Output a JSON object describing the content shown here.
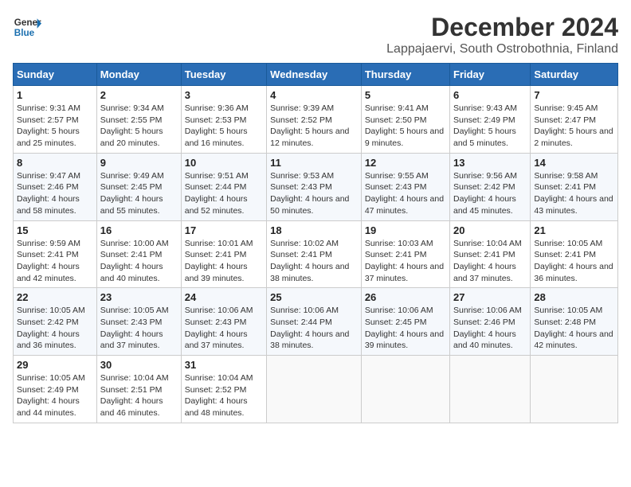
{
  "logo": {
    "general": "General",
    "blue": "Blue"
  },
  "title": "December 2024",
  "subtitle": "Lappajaervi, South Ostrobothnia, Finland",
  "weekdays": [
    "Sunday",
    "Monday",
    "Tuesday",
    "Wednesday",
    "Thursday",
    "Friday",
    "Saturday"
  ],
  "weeks": [
    [
      {
        "day": "1",
        "sunrise": "9:31 AM",
        "sunset": "2:57 PM",
        "daylight": "5 hours and 25 minutes."
      },
      {
        "day": "2",
        "sunrise": "9:34 AM",
        "sunset": "2:55 PM",
        "daylight": "5 hours and 20 minutes."
      },
      {
        "day": "3",
        "sunrise": "9:36 AM",
        "sunset": "2:53 PM",
        "daylight": "5 hours and 16 minutes."
      },
      {
        "day": "4",
        "sunrise": "9:39 AM",
        "sunset": "2:52 PM",
        "daylight": "5 hours and 12 minutes."
      },
      {
        "day": "5",
        "sunrise": "9:41 AM",
        "sunset": "2:50 PM",
        "daylight": "5 hours and 9 minutes."
      },
      {
        "day": "6",
        "sunrise": "9:43 AM",
        "sunset": "2:49 PM",
        "daylight": "5 hours and 5 minutes."
      },
      {
        "day": "7",
        "sunrise": "9:45 AM",
        "sunset": "2:47 PM",
        "daylight": "5 hours and 2 minutes."
      }
    ],
    [
      {
        "day": "8",
        "sunrise": "9:47 AM",
        "sunset": "2:46 PM",
        "daylight": "4 hours and 58 minutes."
      },
      {
        "day": "9",
        "sunrise": "9:49 AM",
        "sunset": "2:45 PM",
        "daylight": "4 hours and 55 minutes."
      },
      {
        "day": "10",
        "sunrise": "9:51 AM",
        "sunset": "2:44 PM",
        "daylight": "4 hours and 52 minutes."
      },
      {
        "day": "11",
        "sunrise": "9:53 AM",
        "sunset": "2:43 PM",
        "daylight": "4 hours and 50 minutes."
      },
      {
        "day": "12",
        "sunrise": "9:55 AM",
        "sunset": "2:43 PM",
        "daylight": "4 hours and 47 minutes."
      },
      {
        "day": "13",
        "sunrise": "9:56 AM",
        "sunset": "2:42 PM",
        "daylight": "4 hours and 45 minutes."
      },
      {
        "day": "14",
        "sunrise": "9:58 AM",
        "sunset": "2:41 PM",
        "daylight": "4 hours and 43 minutes."
      }
    ],
    [
      {
        "day": "15",
        "sunrise": "9:59 AM",
        "sunset": "2:41 PM",
        "daylight": "4 hours and 42 minutes."
      },
      {
        "day": "16",
        "sunrise": "10:00 AM",
        "sunset": "2:41 PM",
        "daylight": "4 hours and 40 minutes."
      },
      {
        "day": "17",
        "sunrise": "10:01 AM",
        "sunset": "2:41 PM",
        "daylight": "4 hours and 39 minutes."
      },
      {
        "day": "18",
        "sunrise": "10:02 AM",
        "sunset": "2:41 PM",
        "daylight": "4 hours and 38 minutes."
      },
      {
        "day": "19",
        "sunrise": "10:03 AM",
        "sunset": "2:41 PM",
        "daylight": "4 hours and 37 minutes."
      },
      {
        "day": "20",
        "sunrise": "10:04 AM",
        "sunset": "2:41 PM",
        "daylight": "4 hours and 37 minutes."
      },
      {
        "day": "21",
        "sunrise": "10:05 AM",
        "sunset": "2:41 PM",
        "daylight": "4 hours and 36 minutes."
      }
    ],
    [
      {
        "day": "22",
        "sunrise": "10:05 AM",
        "sunset": "2:42 PM",
        "daylight": "4 hours and 36 minutes."
      },
      {
        "day": "23",
        "sunrise": "10:05 AM",
        "sunset": "2:43 PM",
        "daylight": "4 hours and 37 minutes."
      },
      {
        "day": "24",
        "sunrise": "10:06 AM",
        "sunset": "2:43 PM",
        "daylight": "4 hours and 37 minutes."
      },
      {
        "day": "25",
        "sunrise": "10:06 AM",
        "sunset": "2:44 PM",
        "daylight": "4 hours and 38 minutes."
      },
      {
        "day": "26",
        "sunrise": "10:06 AM",
        "sunset": "2:45 PM",
        "daylight": "4 hours and 39 minutes."
      },
      {
        "day": "27",
        "sunrise": "10:06 AM",
        "sunset": "2:46 PM",
        "daylight": "4 hours and 40 minutes."
      },
      {
        "day": "28",
        "sunrise": "10:05 AM",
        "sunset": "2:48 PM",
        "daylight": "4 hours and 42 minutes."
      }
    ],
    [
      {
        "day": "29",
        "sunrise": "10:05 AM",
        "sunset": "2:49 PM",
        "daylight": "4 hours and 44 minutes."
      },
      {
        "day": "30",
        "sunrise": "10:04 AM",
        "sunset": "2:51 PM",
        "daylight": "4 hours and 46 minutes."
      },
      {
        "day": "31",
        "sunrise": "10:04 AM",
        "sunset": "2:52 PM",
        "daylight": "4 hours and 48 minutes."
      },
      null,
      null,
      null,
      null
    ]
  ]
}
